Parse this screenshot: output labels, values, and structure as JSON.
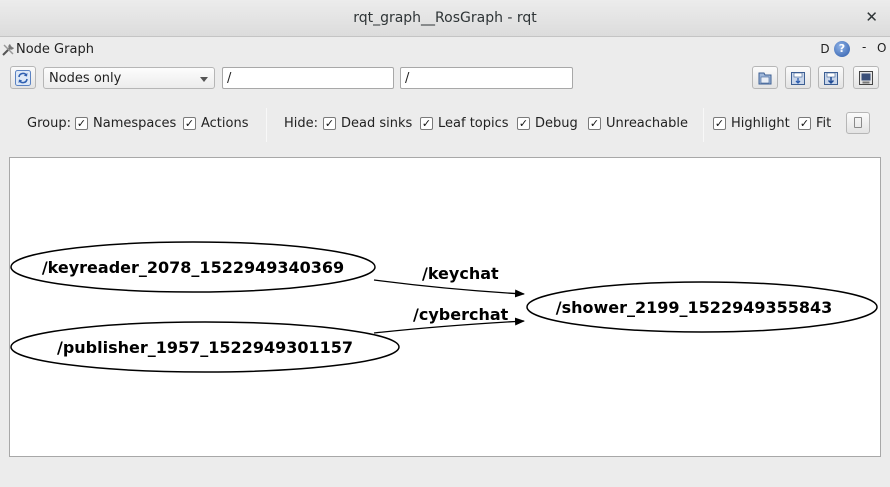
{
  "window": {
    "title": "rqt_graph__RosGraph - rqt",
    "close_glyph": "✕"
  },
  "dock": {
    "title": "Node Graph",
    "d_label": "D",
    "help_glyph": "?",
    "minimize_glyph": "-",
    "float_glyph": "O"
  },
  "toolbar": {
    "refresh_icon": "refresh-icon",
    "graph_mode": "Nodes only",
    "node_filter": "/",
    "topic_filter": "/",
    "right_icons": [
      "load-dot-icon",
      "save-dot-icon",
      "save-svg-icon",
      "save-image-icon"
    ]
  },
  "options": {
    "group_label": "Group:",
    "group_items": [
      "Namespaces",
      "Actions"
    ],
    "hide_label": "Hide:",
    "hide_items": [
      "Dead sinks",
      "Leaf topics",
      "Debug",
      "Unreachable"
    ],
    "view_items": [
      "Highlight",
      "Fit"
    ],
    "check_glyph": "✓"
  },
  "graph": {
    "nodes": [
      {
        "id": "keyreader",
        "label": "/keyreader_2078_1522949340369"
      },
      {
        "id": "publisher",
        "label": "/publisher_1957_1522949301157"
      },
      {
        "id": "shower",
        "label": "/shower_2199_1522949355843"
      }
    ],
    "edges": [
      {
        "from": "keyreader",
        "to": "shower",
        "label": "/keychat"
      },
      {
        "from": "publisher",
        "to": "shower",
        "label": "/cyberchat"
      }
    ]
  }
}
